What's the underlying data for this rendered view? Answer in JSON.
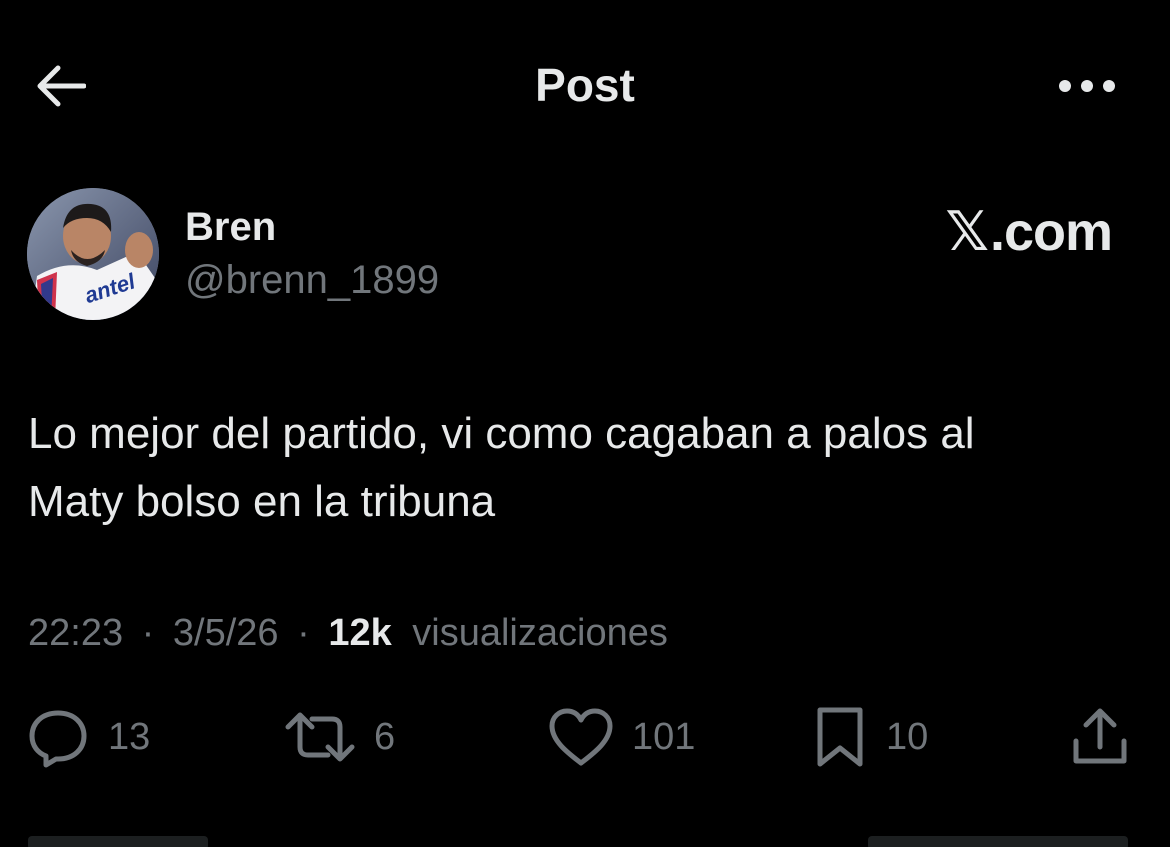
{
  "header": {
    "title": "Post",
    "back_icon": "arrow-left-icon",
    "more_icon": "more-horizontal-icon"
  },
  "author": {
    "name": "Bren",
    "handle": "@brenn_1899",
    "avatar_jersey_text": "antel"
  },
  "watermark": {
    "x_glyph": "𝕏",
    "text": ".com"
  },
  "tweet": {
    "line1": "Lo mejor del partido, vi como cagaban a palos al",
    "line2": "Maty bolso en la tribuna"
  },
  "meta": {
    "time": "22:23",
    "separator": "·",
    "date": "3/5/26",
    "views_count": "12k",
    "views_label": "visualizaciones"
  },
  "actions": {
    "reply": {
      "icon": "reply-icon",
      "count": "13"
    },
    "retweet": {
      "icon": "retweet-icon",
      "count": "6"
    },
    "like": {
      "icon": "heart-icon",
      "count": "101"
    },
    "bookmark": {
      "icon": "bookmark-icon",
      "count": "10"
    },
    "share": {
      "icon": "share-icon"
    }
  },
  "colors": {
    "background": "#000000",
    "primary_text": "#e7e9ea",
    "secondary_text": "#71767b"
  }
}
